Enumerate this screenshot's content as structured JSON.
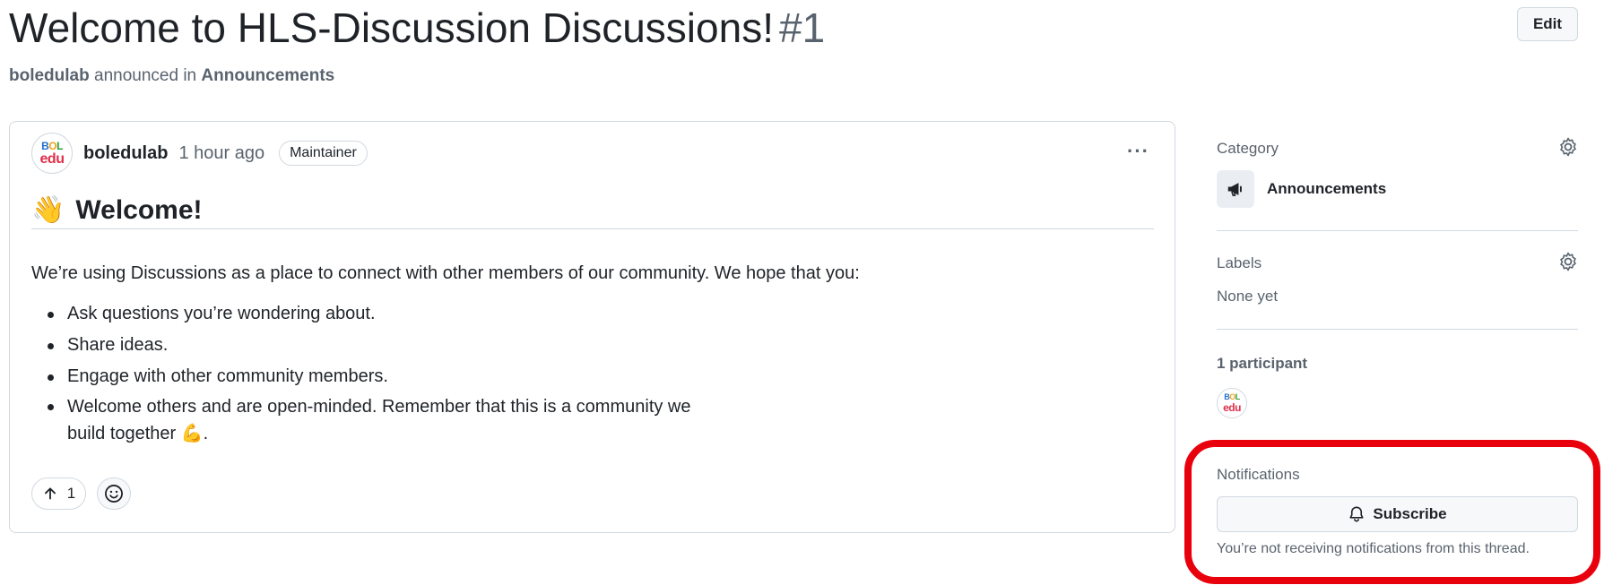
{
  "discussion": {
    "title": "Welcome to HLS-Discussion Discussions!",
    "number": "#1",
    "edit_label": "Edit",
    "byline": {
      "author": "boledulab",
      "verb": "announced in",
      "category": "Announcements"
    }
  },
  "post": {
    "author": "boledulab",
    "time": "1 hour ago",
    "badge": "Maintainer",
    "menu_label": "···",
    "heading_emoji": "👋",
    "heading": "Welcome!",
    "intro": "We’re using Discussions as a place to connect with other members of our community. We hope that you:",
    "bullets": [
      "Ask questions you’re wondering about.",
      "Share ideas.",
      "Engage with other community members."
    ],
    "last_bullet_line1": "Welcome others and are open-minded. Remember that this is a community we",
    "last_bullet_line2": "build together",
    "last_bullet_emoji": "💪",
    "last_bullet_tail": ".",
    "upvotes": "1"
  },
  "avatar": {
    "line1": [
      "B",
      "O",
      "L"
    ],
    "line2": "edu"
  },
  "sidebar": {
    "category_label": "Category",
    "category_name": "Announcements",
    "labels_label": "Labels",
    "labels_value": "None yet",
    "participants_label": "1 participant",
    "notifications_label": "Notifications",
    "subscribe_label": "Subscribe",
    "notifications_status": "You’re not receiving notifications from this thread."
  },
  "colors": {
    "highlight": "#e8000c",
    "border": "#d1d9e0",
    "muted": "#59636e"
  }
}
